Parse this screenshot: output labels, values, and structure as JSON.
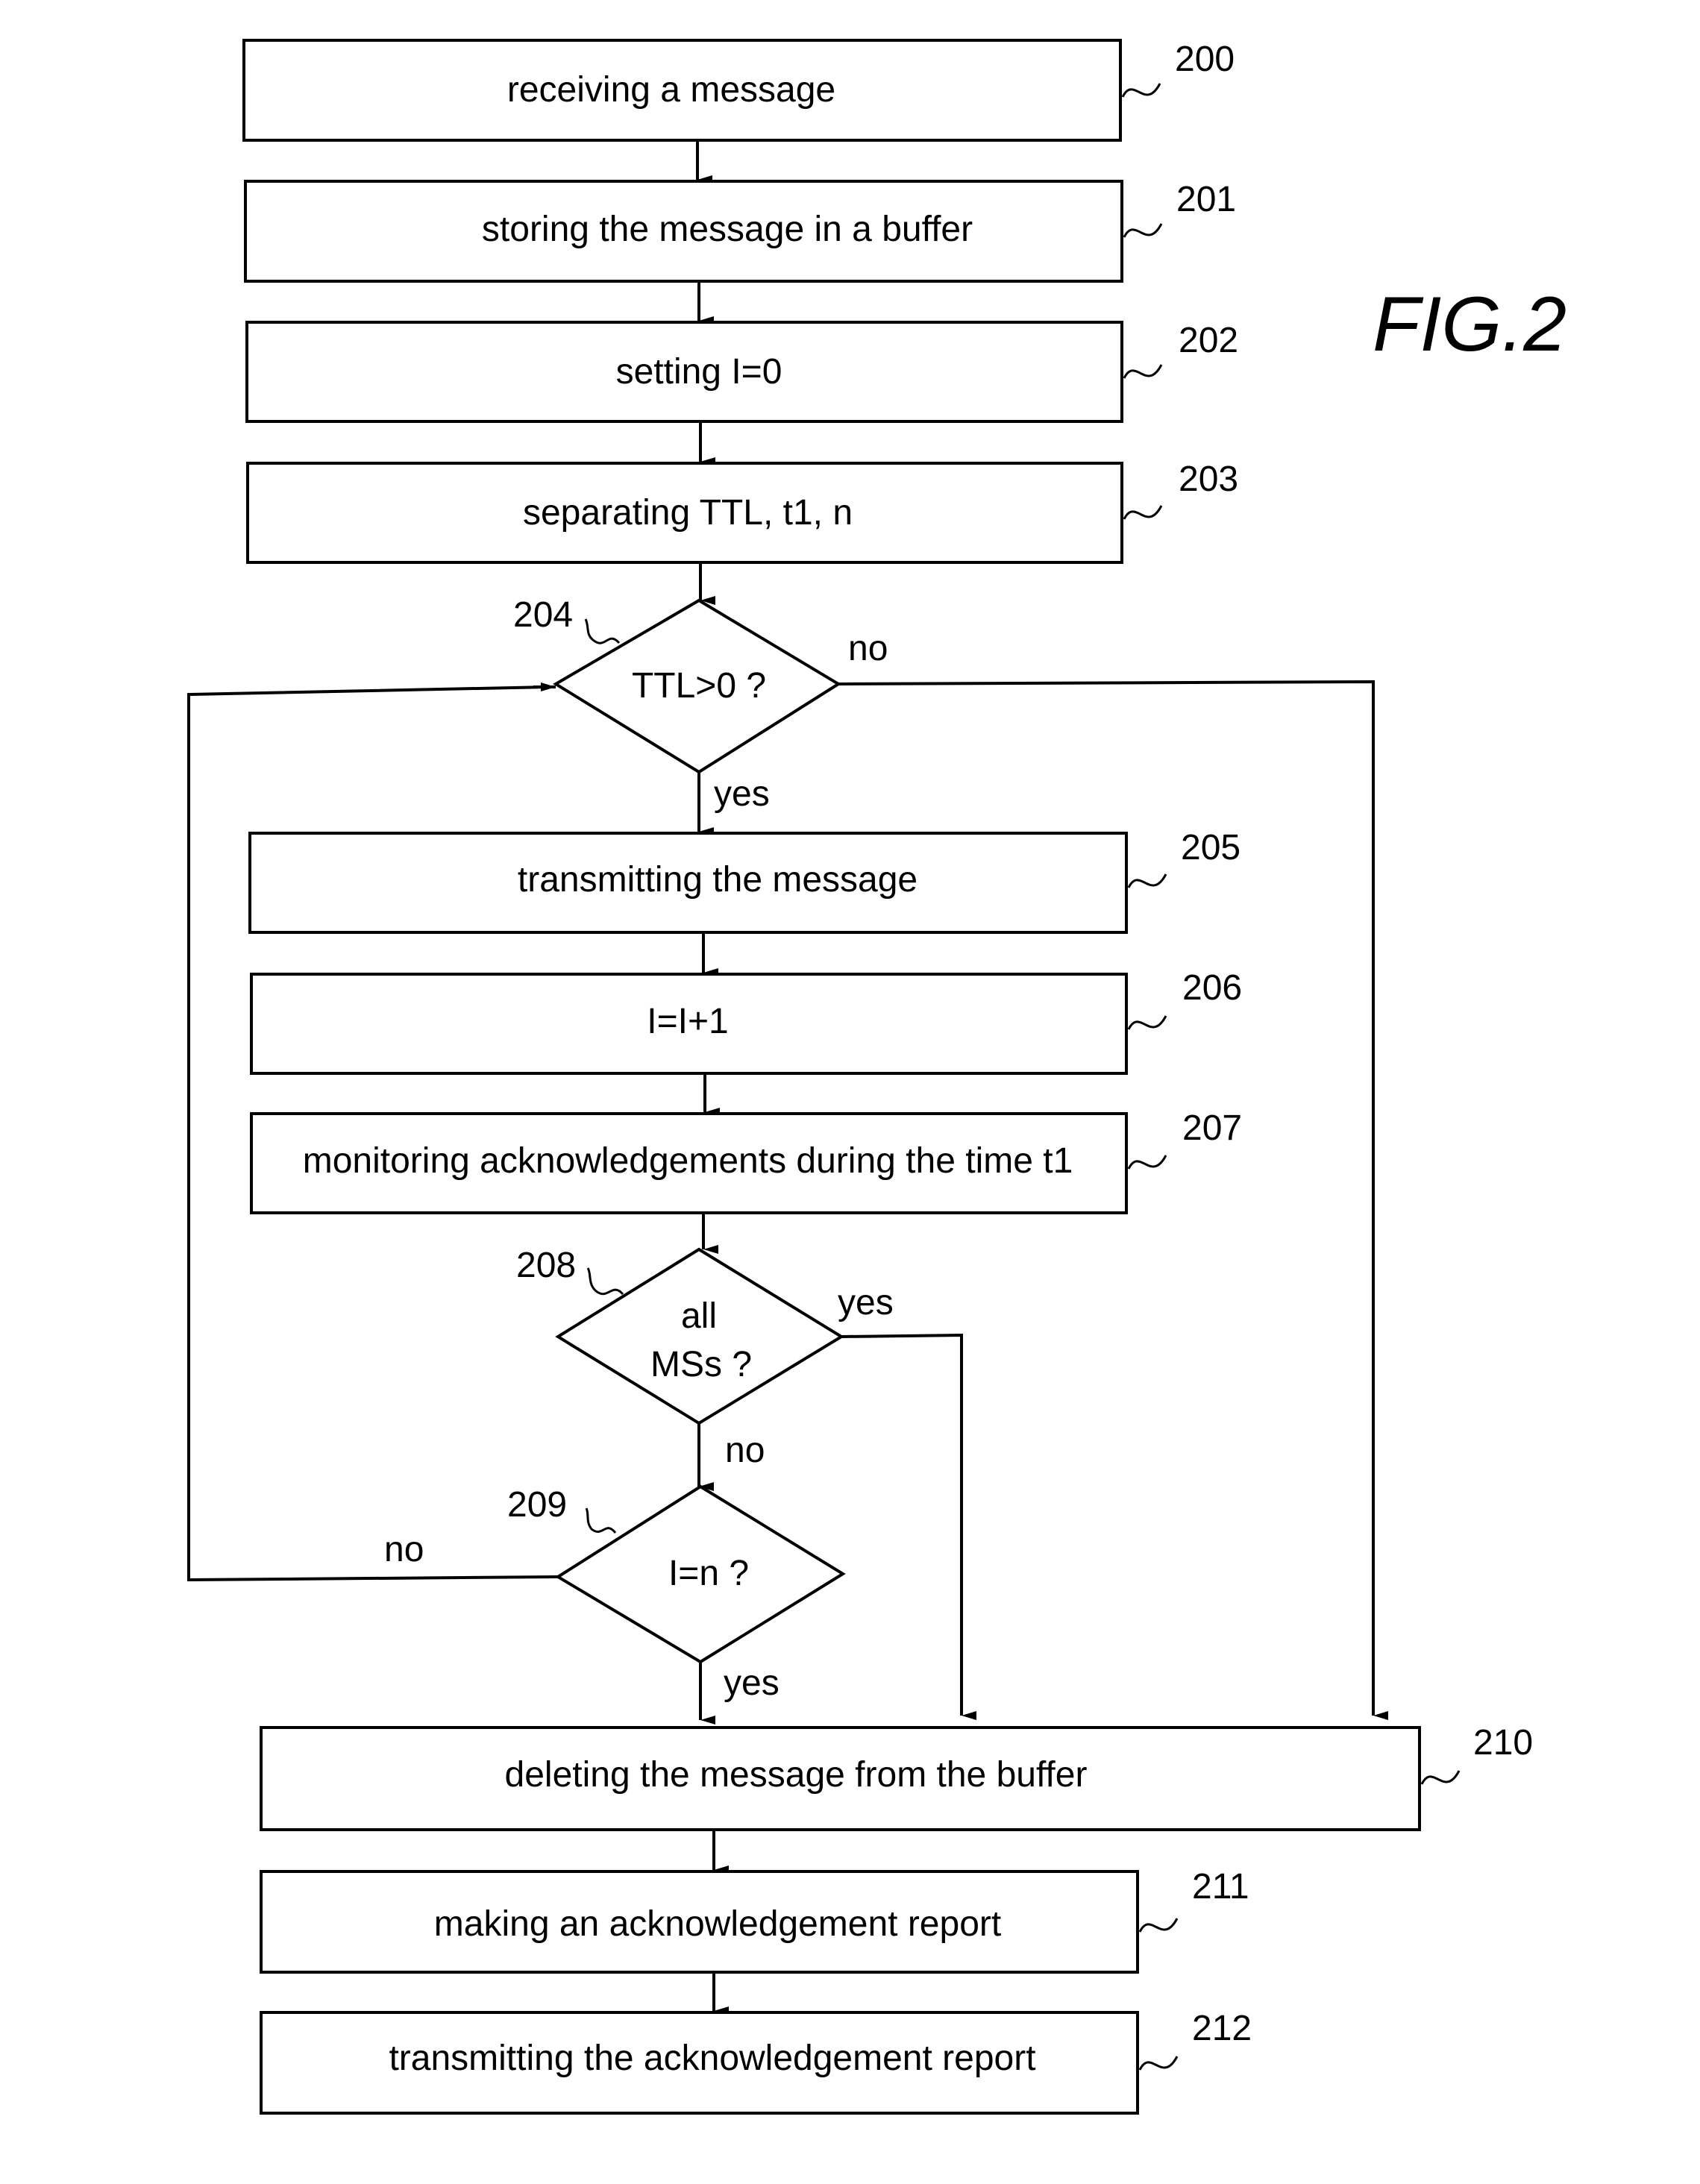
{
  "figure_label": "FIG.2",
  "steps": [
    {
      "ref": "200",
      "text": "receiving a message"
    },
    {
      "ref": "201",
      "text": "storing the message in a buffer"
    },
    {
      "ref": "202",
      "text": "setting I=0"
    },
    {
      "ref": "203",
      "text": "separating TTL, t1, n"
    },
    {
      "ref": "205",
      "text": "transmitting the message"
    },
    {
      "ref": "206",
      "text": "I=I+1"
    },
    {
      "ref": "207",
      "text": "monitoring acknowledgements during the time t1"
    },
    {
      "ref": "210",
      "text": "deleting the message from the buffer"
    },
    {
      "ref": "211",
      "text": "making an acknowledgement report"
    },
    {
      "ref": "212",
      "text": "transmitting the acknowledgement report"
    }
  ],
  "decisions": [
    {
      "ref": "204",
      "line1": "TTL>0 ?",
      "line2": "",
      "yes_label": "yes",
      "no_label": "no"
    },
    {
      "ref": "208",
      "line1": "all",
      "line2": "MSs ?",
      "yes_label": "yes",
      "no_label": "no"
    },
    {
      "ref": "209",
      "line1": "I=n ?",
      "line2": "",
      "yes_label": "yes",
      "no_label": "no"
    }
  ]
}
